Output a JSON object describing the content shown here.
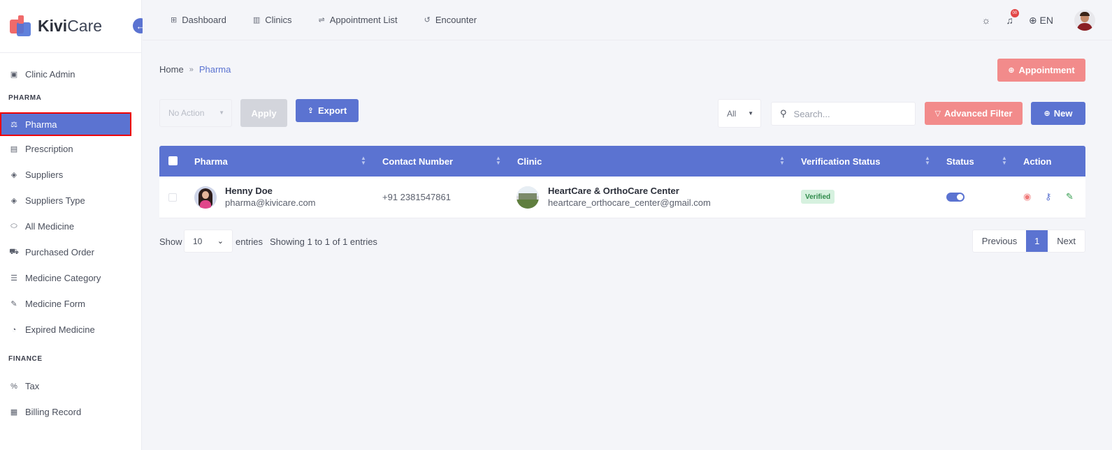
{
  "brand": {
    "name_bold": "Kivi",
    "name_light": "Care"
  },
  "sidebar": {
    "items_top": [
      {
        "label": "Clinic Admin",
        "icon": "id-card-icon"
      }
    ],
    "sections": [
      {
        "title": "PHARMA",
        "items": [
          {
            "label": "Pharma",
            "icon": "scale-icon",
            "active": true
          },
          {
            "label": "Prescription",
            "icon": "clipboard-icon"
          },
          {
            "label": "Suppliers",
            "icon": "handshake-icon"
          },
          {
            "label": "Suppliers Type",
            "icon": "handshake-icon"
          },
          {
            "label": "All Medicine",
            "icon": "pill-icon"
          },
          {
            "label": "Purchased Order",
            "icon": "cart-icon"
          },
          {
            "label": "Medicine Category",
            "icon": "list-icon"
          },
          {
            "label": "Medicine Form",
            "icon": "syringe-icon"
          },
          {
            "label": "Expired Medicine",
            "icon": "clock-icon"
          }
        ]
      },
      {
        "title": "FINANCE",
        "items": [
          {
            "label": "Tax",
            "icon": "percent-icon"
          },
          {
            "label": "Billing Record",
            "icon": "receipt-icon"
          }
        ]
      }
    ]
  },
  "topnav": [
    {
      "label": "Dashboard",
      "icon": "grid-icon"
    },
    {
      "label": "Clinics",
      "icon": "building-icon"
    },
    {
      "label": "Appointment List",
      "icon": "sliders-icon"
    },
    {
      "label": "Encounter",
      "icon": "history-icon"
    }
  ],
  "topright": {
    "notification_count": "00",
    "language": "EN"
  },
  "breadcrumb": {
    "home": "Home",
    "current": "Pharma"
  },
  "buttons": {
    "appointment": "Appointment",
    "apply": "Apply",
    "export": "Export",
    "advanced_filter": "Advanced Filter",
    "new": "New"
  },
  "bulk_action": {
    "selected": "No Action"
  },
  "filter": {
    "selected": "All"
  },
  "search": {
    "placeholder": "Search..."
  },
  "table": {
    "columns": [
      "Pharma",
      "Contact Number",
      "Clinic",
      "Verification Status",
      "Status",
      "Action"
    ],
    "rows": [
      {
        "name": "Henny Doe",
        "email": "pharma@kivicare.com",
        "phone": "+91 2381547861",
        "clinic_name": "HeartCare & OrthoCare Center",
        "clinic_email": "heartcare_orthocare_center@gmail.com",
        "verification": "Verified",
        "status_on": true
      }
    ]
  },
  "footer": {
    "show": "Show",
    "page_length": "10",
    "entries": "entries",
    "info": "Showing 1 to 1 of 1 entries",
    "previous": "Previous",
    "current_page": "1",
    "next": "Next"
  },
  "colors": {
    "primary": "#5b73d1",
    "accent": "#f28b8b",
    "verified_bg": "#d6f1df",
    "verified_text": "#2f8a4a"
  }
}
